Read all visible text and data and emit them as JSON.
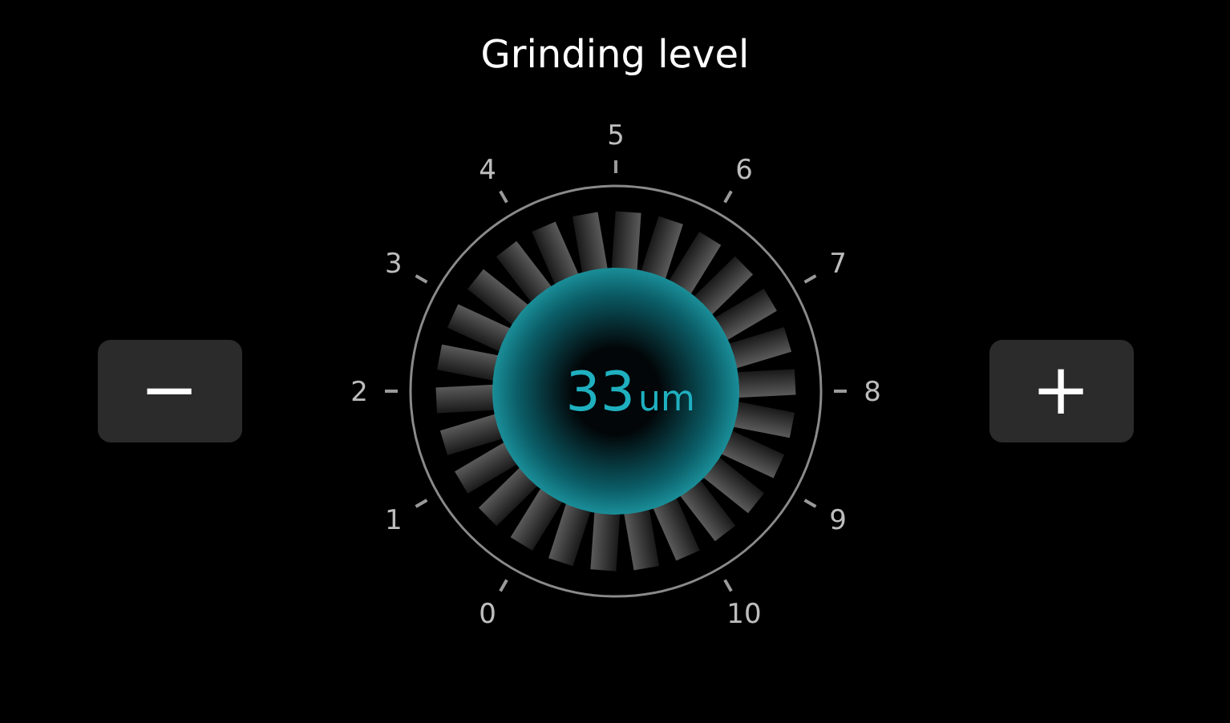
{
  "title": "Grinding level",
  "decrease_button": {
    "label": "−"
  },
  "increase_button": {
    "label": "+"
  },
  "dial": {
    "value": "33",
    "unit": "um",
    "scale": [
      "0",
      "1",
      "2",
      "3",
      "4",
      "5",
      "6",
      "7",
      "8",
      "9",
      "10"
    ]
  }
}
